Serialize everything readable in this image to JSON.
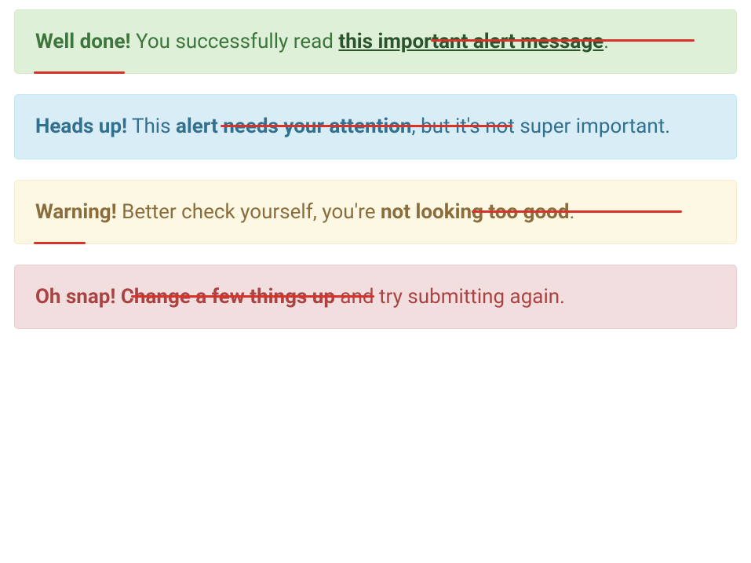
{
  "alerts": [
    {
      "variant": "success",
      "heading": "Well done!",
      "pre": " You successfully read ",
      "link": "this important alert message",
      "post": "."
    },
    {
      "variant": "info",
      "heading": "Heads up!",
      "pre": " This ",
      "bold": "alert needs your attention",
      "post": ", but it's not super important."
    },
    {
      "variant": "warning",
      "heading": "Warning!",
      "pre": " Better check yourself, you're ",
      "bold": "not looking too good",
      "post": "."
    },
    {
      "variant": "danger",
      "heading": "Oh snap!",
      "pre": " ",
      "bold": "Change a few things up",
      "post": " and try submitting again."
    }
  ],
  "annotation_color": "#d9322b"
}
